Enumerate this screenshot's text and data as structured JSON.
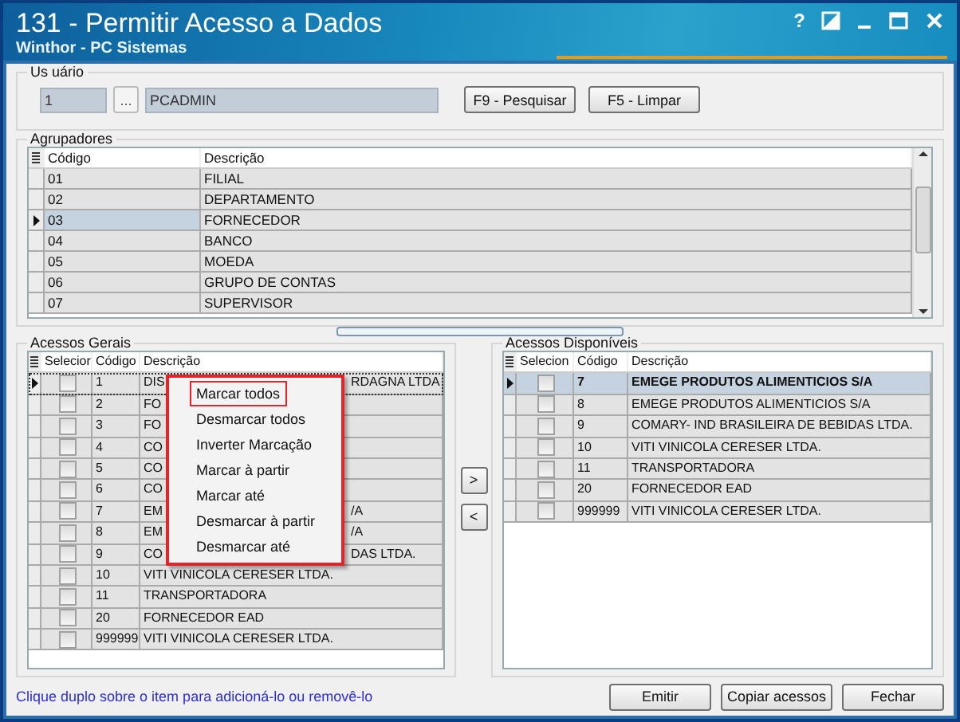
{
  "window": {
    "title": "131 - Permitir Acesso a Dados",
    "subtitle": "Winthor - PC Sistemas",
    "help": "?"
  },
  "usuario": {
    "label": "Us uário",
    "code": "1",
    "browse": "...",
    "name": "PCADMIN",
    "buttons": [
      "F9 - Pesquisar",
      "F5 - Limpar"
    ]
  },
  "agrupadores": {
    "label": "Agrupadores",
    "columns": [
      "Código",
      "Descrição"
    ],
    "rows": [
      {
        "code": "01",
        "description": "FILIAL",
        "selected": false
      },
      {
        "code": "02",
        "description": "DEPARTAMENTO",
        "selected": false
      },
      {
        "code": "03",
        "description": "FORNECEDOR",
        "selected": true
      },
      {
        "code": "04",
        "description": "BANCO",
        "selected": false
      },
      {
        "code": "05",
        "description": "MOEDA",
        "selected": false
      },
      {
        "code": "06",
        "description": "GRUPO DE CONTAS",
        "selected": false
      },
      {
        "code": "07",
        "description": "SUPERVISOR",
        "selected": false
      }
    ]
  },
  "acessos_gerais": {
    "label": "Acessos Gerais",
    "columns": [
      "Selecior",
      "Código",
      "Descrição"
    ],
    "rows": [
      {
        "code": "1",
        "description": "DIS",
        "description_tail": "RDAGNA LTDA",
        "checked": false,
        "selected": true
      },
      {
        "code": "2",
        "description": "FO",
        "checked": false,
        "selected": false
      },
      {
        "code": "3",
        "description": "FO",
        "checked": false,
        "selected": false
      },
      {
        "code": "4",
        "description": "CO",
        "checked": false,
        "selected": false
      },
      {
        "code": "5",
        "description": "CO",
        "checked": false,
        "selected": false
      },
      {
        "code": "6",
        "description": "CO",
        "checked": false,
        "selected": false
      },
      {
        "code": "7",
        "description": "EM",
        "description_tail": "/A",
        "checked": false,
        "selected": false
      },
      {
        "code": "8",
        "description": "EM",
        "description_tail": "/A",
        "checked": false,
        "selected": false
      },
      {
        "code": "9",
        "description": "CO",
        "description_tail": "DAS LTDA.",
        "checked": false,
        "selected": false
      },
      {
        "code": "10",
        "description": "VITI VINICOLA CERESER LTDA.",
        "checked": false,
        "selected": false
      },
      {
        "code": "11",
        "description": "TRANSPORTADORA",
        "checked": false,
        "selected": false
      },
      {
        "code": "20",
        "description": "FORNECEDOR EAD",
        "checked": false,
        "selected": false
      },
      {
        "code": "999999",
        "description": "VITI VINICOLA CERESER LTDA.",
        "checked": false,
        "selected": false
      }
    ],
    "hint": "Clique duplo sobre o item para adicioná-lo ou removê-lo"
  },
  "context_menu": {
    "items": [
      {
        "label": "Marcar todos",
        "highlighted": true
      },
      {
        "label": "Desmarcar todos",
        "highlighted": false
      },
      {
        "label": "Inverter Marcação",
        "highlighted": false
      },
      {
        "label": "Marcar à partir",
        "highlighted": false
      },
      {
        "label": "Marcar até",
        "highlighted": false
      },
      {
        "label": "Desmarcar à partir",
        "highlighted": false
      },
      {
        "label": "Desmarcar até",
        "highlighted": false
      }
    ]
  },
  "move_buttons": [
    ">",
    "<"
  ],
  "acessos_disponiveis": {
    "label": "Acessos Disponíveis",
    "columns": [
      "Selecion",
      "Código",
      "Descrição"
    ],
    "rows": [
      {
        "code": "7",
        "description": "EMEGE PRODUTOS ALIMENTICIOS S/A",
        "checked": false,
        "selected": true
      },
      {
        "code": "8",
        "description": "EMEGE PRODUTOS ALIMENTICIOS S/A",
        "checked": false,
        "selected": false
      },
      {
        "code": "9",
        "description": "COMARY- IND BRASILEIRA DE BEBIDAS LTDA.",
        "checked": false,
        "selected": false
      },
      {
        "code": "10",
        "description": "VITI VINICOLA CERESER LTDA.",
        "checked": false,
        "selected": false
      },
      {
        "code": "11",
        "description": "TRANSPORTADORA",
        "checked": false,
        "selected": false
      },
      {
        "code": "20",
        "description": "FORNECEDOR EAD",
        "checked": false,
        "selected": false
      },
      {
        "code": "999999",
        "description": "VITI VINICOLA CERESER LTDA.",
        "checked": false,
        "selected": false
      }
    ]
  },
  "footer_buttons": [
    "Emitir",
    "Copiar acessos",
    "Fechar"
  ]
}
